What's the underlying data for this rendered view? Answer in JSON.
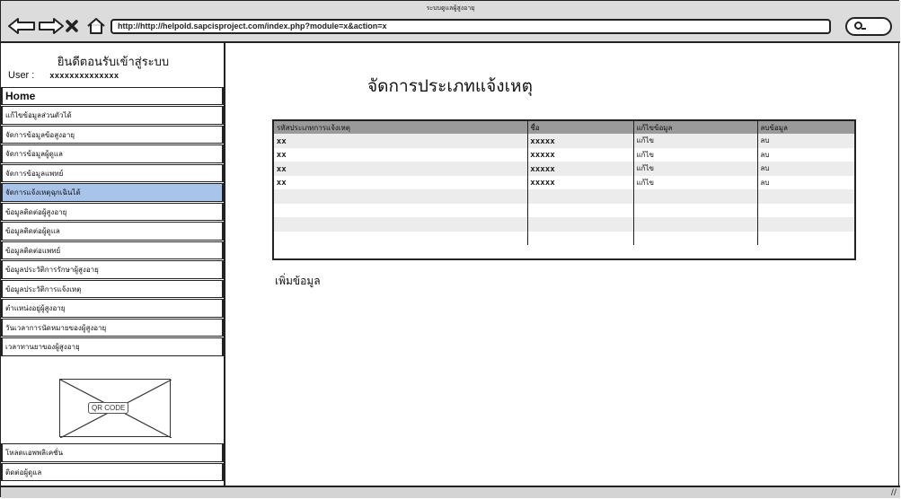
{
  "window": {
    "title": "ระบบดูแลผู้สูงอายุ",
    "url": "http://http://helpold.sapcisproject.com/index.php?module=x&action=x"
  },
  "sidebar": {
    "welcome": "ยินดีตอนรับเข้าสู่ระบบ",
    "user_label": "User :",
    "user_value": "xxxxxxxxxxxxxx",
    "home": "Home",
    "items": [
      {
        "label": "แก้ไขข้อมูลส่วนตัวได้"
      },
      {
        "label": "จัดการข้อมูลข้อสูงอายุ"
      },
      {
        "label": "จัดการข้อมูลผู้ดูแล"
      },
      {
        "label": "จัดการข้อมูลแพทย์"
      },
      {
        "label": "จัดการแจ้งเหตุฉุกเฉินได้"
      },
      {
        "label": "ข้อมูลติดต่อผู้สูงอายุ"
      },
      {
        "label": "ข้อมูลติดต่อผู้ดูแล"
      },
      {
        "label": "ข้อมูลติดต่อแพทย์"
      },
      {
        "label": "ข้อมูลประวัติการรักษาผู้สูงอายุ"
      },
      {
        "label": "ข้อมูลประวัติการแจ้งเหตุ"
      },
      {
        "label": "ตำแหน่งอยู่ผู้สูงอายุ"
      },
      {
        "label": "วันเวลาการนัดหมายของผู้สูงอายุ"
      },
      {
        "label": "เวลาทานยาของผู้สูงอายุ"
      }
    ],
    "active_index": 4,
    "qr_label": "QR CODE",
    "bottom_items": [
      {
        "label": "โหลดแอพพลิเคชั่น"
      },
      {
        "label": "ติดต่อผู้ดูแล"
      }
    ]
  },
  "main": {
    "title": "จัดการประเภทแจ้งเหตุ",
    "table": {
      "headers": [
        "รหัสประเภทการแจ้งเหตุ",
        "ชื่อ",
        "แก้ไขข้อมูล",
        "ลบข้อมูล"
      ],
      "rows": [
        [
          "xx",
          "xxxxx",
          "แก้ไข",
          "ลบ"
        ],
        [
          "xx",
          "xxxxx",
          "แก้ไข",
          "ลบ"
        ],
        [
          "xx",
          "xxxxx",
          "แก้ไข",
          "ลบ"
        ],
        [
          "xx",
          "xxxxx",
          "แก้ไข",
          "ลบ"
        ],
        [
          "",
          "",
          "",
          ""
        ],
        [
          "",
          "",
          "",
          ""
        ],
        [
          "",
          "",
          "",
          ""
        ],
        [
          "",
          "",
          "",
          ""
        ]
      ]
    },
    "add_label": "เพิ่มข้อมูล"
  },
  "icons": {
    "back": "arrow-left-icon",
    "forward": "arrow-right-icon",
    "stop": "close-icon",
    "home": "home-icon",
    "search": "search-icon",
    "resize": "resize-grip-icon"
  },
  "colors": {
    "active_menu": "#a9c4eb",
    "table_header": "#9a9a9a",
    "stripe": "#ececec"
  }
}
